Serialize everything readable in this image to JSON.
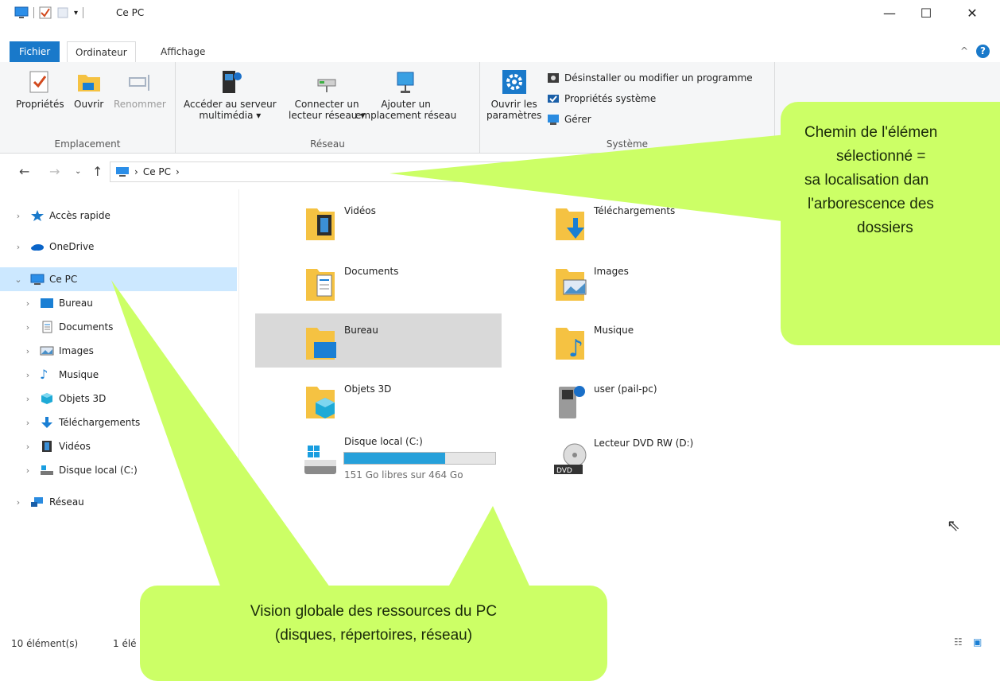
{
  "window": {
    "title": "Ce PC"
  },
  "tabs": {
    "file": "Fichier",
    "computer": "Ordinateur",
    "view": "Affichage"
  },
  "ribbon": {
    "groups": {
      "location": "Emplacement",
      "network": "Réseau",
      "system": "Système"
    },
    "properties": "Propriétés",
    "open": "Ouvrir",
    "rename": "Renommer",
    "media_server": [
      "Accéder au serveur",
      "multimédia ▾"
    ],
    "map_drive": [
      "Connecter un",
      "lecteur réseau ▾"
    ],
    "add_location": [
      "Ajouter un",
      "emplacement réseau"
    ],
    "open_settings": [
      "Ouvrir les",
      "paramètres"
    ],
    "uninstall": "Désinstaller ou modifier un programme",
    "sys_props": "Propriétés système",
    "manage": "Gérer"
  },
  "address": {
    "crumb": "Ce PC",
    "sep": "›"
  },
  "sidebar": {
    "quick": "Accès rapide",
    "onedrive": "OneDrive",
    "thispc": "Ce PC",
    "desktop": "Bureau",
    "documents": "Documents",
    "images": "Images",
    "music": "Musique",
    "objects3d": "Objets 3D",
    "downloads": "Téléchargements",
    "videos": "Vidéos",
    "localdisk": "Disque local (C:)",
    "network": "Réseau"
  },
  "content": {
    "videos": "Vidéos",
    "downloads": "Téléchargements",
    "documents": "Documents",
    "images": "Images",
    "desktop": "Bureau",
    "music": "Musique",
    "objects3d": "Objets 3D",
    "user": "user (pail-pc)",
    "localdisk": "Disque local (C:)",
    "disk_free": "151 Go libres sur 464 Go",
    "disk_used_fraction": 0.67,
    "dvd": "Lecteur DVD RW (D:)"
  },
  "status": {
    "count": "10 élément(s)",
    "selected": "1 élé"
  },
  "callouts": {
    "right": [
      "Chemin de l'élémen",
      "sélectionné =",
      "sa localisation dan",
      "l'arborescence des",
      "dossiers"
    ],
    "bottom": [
      "Vision globale des ressources du PC",
      "(disques, répertoires, réseau)"
    ]
  },
  "colors": {
    "accent": "#1979ca",
    "callout": "#ccff66",
    "selection": "#cce8ff",
    "drive_fill": "#26a0da"
  }
}
